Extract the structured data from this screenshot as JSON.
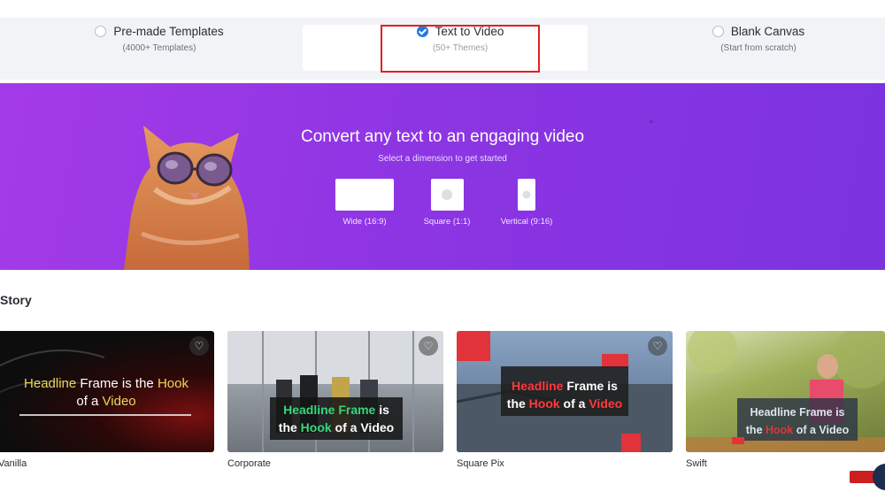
{
  "options": [
    {
      "title": "Pre-made Templates",
      "sub": "(4000+ Templates)",
      "selected": false
    },
    {
      "title": "Text to Video",
      "sub": "(50+ Themes)",
      "selected": true
    },
    {
      "title": "Blank Canvas",
      "sub": "(Start from scratch)",
      "selected": false
    }
  ],
  "hero": {
    "title": "Convert any text to an engaging video",
    "subtitle": "Select a dimension to get started",
    "dimensions": [
      {
        "label": "Wide (16:9)"
      },
      {
        "label": "Square (1:1)"
      },
      {
        "label": "Vertical (9:16)"
      }
    ]
  },
  "section": {
    "title": "Story"
  },
  "cards": [
    {
      "name": "Vanilla",
      "caption_a": "Headline",
      "caption_b": " Frame is the ",
      "caption_c": "Hook",
      "caption_d": "of a ",
      "caption_e": "Video"
    },
    {
      "name": "Corporate",
      "caption_a": "Headline Frame",
      "caption_b": " is",
      "caption_c": "the ",
      "caption_d": "Hook",
      "caption_e": " of a Video"
    },
    {
      "name": "Square Pix",
      "caption_a": "Headline",
      "caption_b": " Frame is",
      "caption_c": "the ",
      "caption_d": "Hook",
      "caption_e": " of a ",
      "caption_f": "Video"
    },
    {
      "name": "Swift",
      "caption_a": "Headline Frame is",
      "caption_b": "the ",
      "caption_c": "Hook",
      "caption_d": " of a Video"
    }
  ],
  "colors": {
    "accent": "#1f7ae0",
    "hero_start": "#a53be8",
    "hero_end": "#7b33df",
    "highlight_red": "#e02020"
  }
}
